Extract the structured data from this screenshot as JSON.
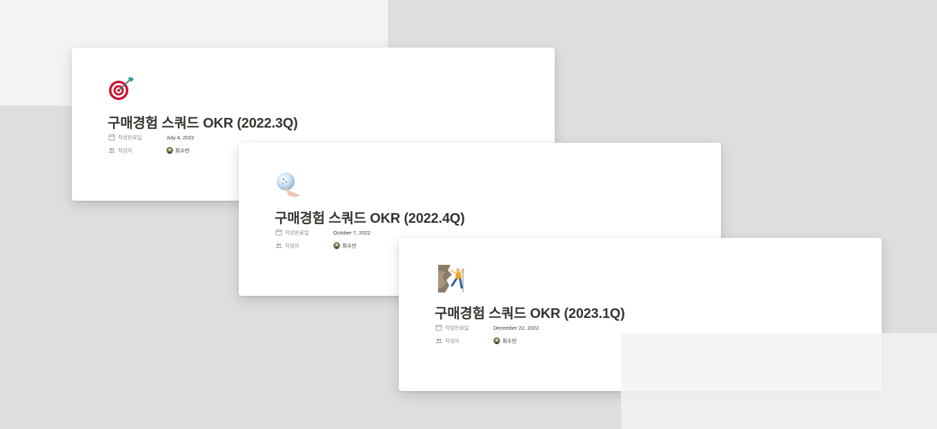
{
  "colors": {
    "background": "#dedede",
    "panel": "#f3f3f3",
    "card": "#ffffff",
    "title_text": "#37352f",
    "property_label": "#8a8986"
  },
  "cards": [
    {
      "icon": "direct-hit-target-icon",
      "title": "구매경험 스쿼드 OKR (2022.3Q)",
      "properties": {
        "date_label": "작성완료일",
        "date_value": "July 4, 2022",
        "author_label": "작성자",
        "author_name": "최수빈"
      }
    },
    {
      "icon": "crystal-ball-hand-icon",
      "title": "구매경험 스쿼드 OKR (2022.4Q)",
      "properties": {
        "date_label": "작성완료일",
        "date_value": "October 7, 2022",
        "author_label": "작성자",
        "author_name": "최수빈"
      }
    },
    {
      "icon": "person-climbing-icon",
      "title": "구매경험 스쿼드 OKR (2023.1Q)",
      "properties": {
        "date_label": "작성완료일",
        "date_value": "December 22, 2022",
        "author_label": "작성자",
        "author_name": "최수빈"
      }
    }
  ]
}
